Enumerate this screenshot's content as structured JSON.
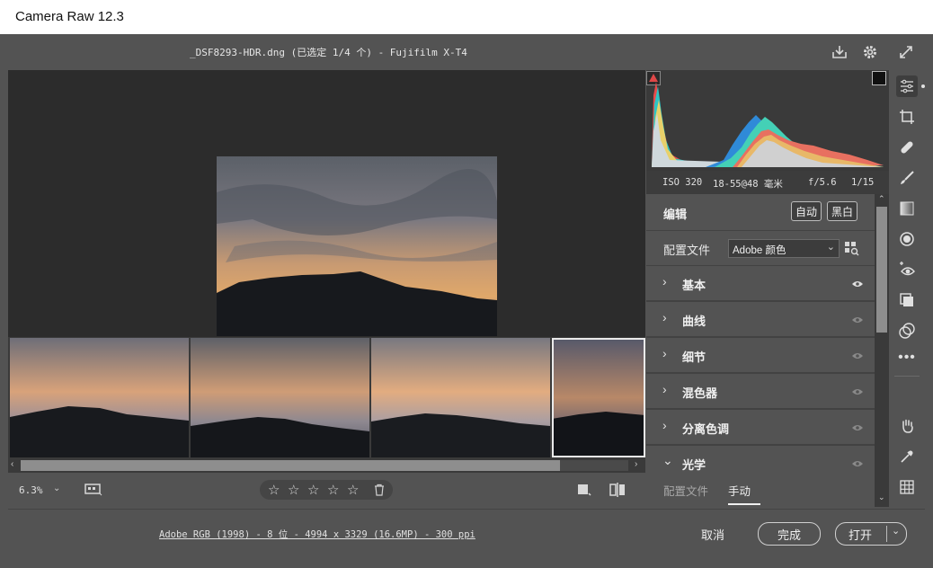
{
  "window": {
    "title": "Camera Raw 12.3"
  },
  "header": {
    "filename": "_DSF8293-HDR.dng (已选定 1/4 个) - Fujifilm X-T4",
    "icons": [
      "save-icon",
      "gear-icon",
      "fullscreen-icon"
    ]
  },
  "exif": {
    "iso": "ISO 320",
    "lens": "18-55@48 毫米",
    "aperture": "f/5.6",
    "shutter": "1/15"
  },
  "edit": {
    "title": "编辑",
    "auto_label": "自动",
    "bw_label": "黑白",
    "profile_label": "配置文件",
    "profile_value": "Adobe 颜色",
    "sections": [
      {
        "label": "基本"
      },
      {
        "label": "曲线"
      },
      {
        "label": "细节"
      },
      {
        "label": "混色器"
      },
      {
        "label": "分离色调"
      },
      {
        "label": "光学"
      }
    ],
    "optics_tabs": [
      "配置文件",
      "手动"
    ]
  },
  "view": {
    "zoom": "6.3%"
  },
  "rating": {
    "stars": 0,
    "max": 5
  },
  "footer": {
    "meta": "Adobe RGB (1998) - 8 位 - 4994 x 3329 (16.6MP) - 300 ppi",
    "cancel_label": "取消",
    "done_label": "完成",
    "open_label": "打开"
  },
  "colors": {
    "panel": "#535353",
    "canvas": "#2c2c2c",
    "accent": "#e0e0e0"
  },
  "tools": [
    "sliders-icon",
    "crop-icon",
    "healing-icon",
    "brush-icon",
    "gradient-icon",
    "radial-icon",
    "redeye-icon",
    "snapshots-icon",
    "presets-icon",
    "more-icon",
    "hand-icon",
    "eyedropper-icon",
    "grid-icon"
  ]
}
